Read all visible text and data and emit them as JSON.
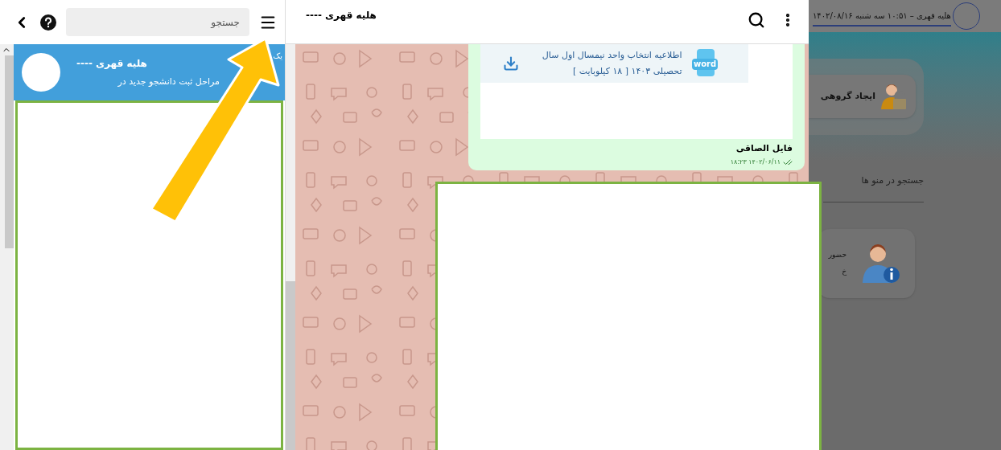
{
  "left_panel": {
    "search": {
      "placeholder": "جستجو"
    },
    "chat_item": {
      "selected": true,
      "corner_text": "یک",
      "name": "هلیه قهری ----",
      "preview": "مراحل ثبت دانشجو جدید در"
    }
  },
  "chat": {
    "title": "هلیه قهری ----",
    "message": {
      "file_type": "word",
      "file_name": "اطلاعیه انتخاب واحد نیمسال اول سال تحصیلی ۱۴۰۳ [ ۱۸ کیلوبایت ]",
      "caption": "فایل الصاقی",
      "time": "۱۴۰۲/۰۶/۱۱ ۱۸:۲۳",
      "read": true
    }
  },
  "background_page": {
    "header": "هلیه قهری – ۱۰:۵۱ سه شنبه ۱۴۰۲/۰۸/۱۶",
    "group_card": {
      "title": "ایجاد گروهی"
    },
    "menu_search": {
      "placeholder": "جستجو در منو ها"
    },
    "info_card": {
      "lines": [
        "حضور",
        "خ"
      ]
    }
  }
}
